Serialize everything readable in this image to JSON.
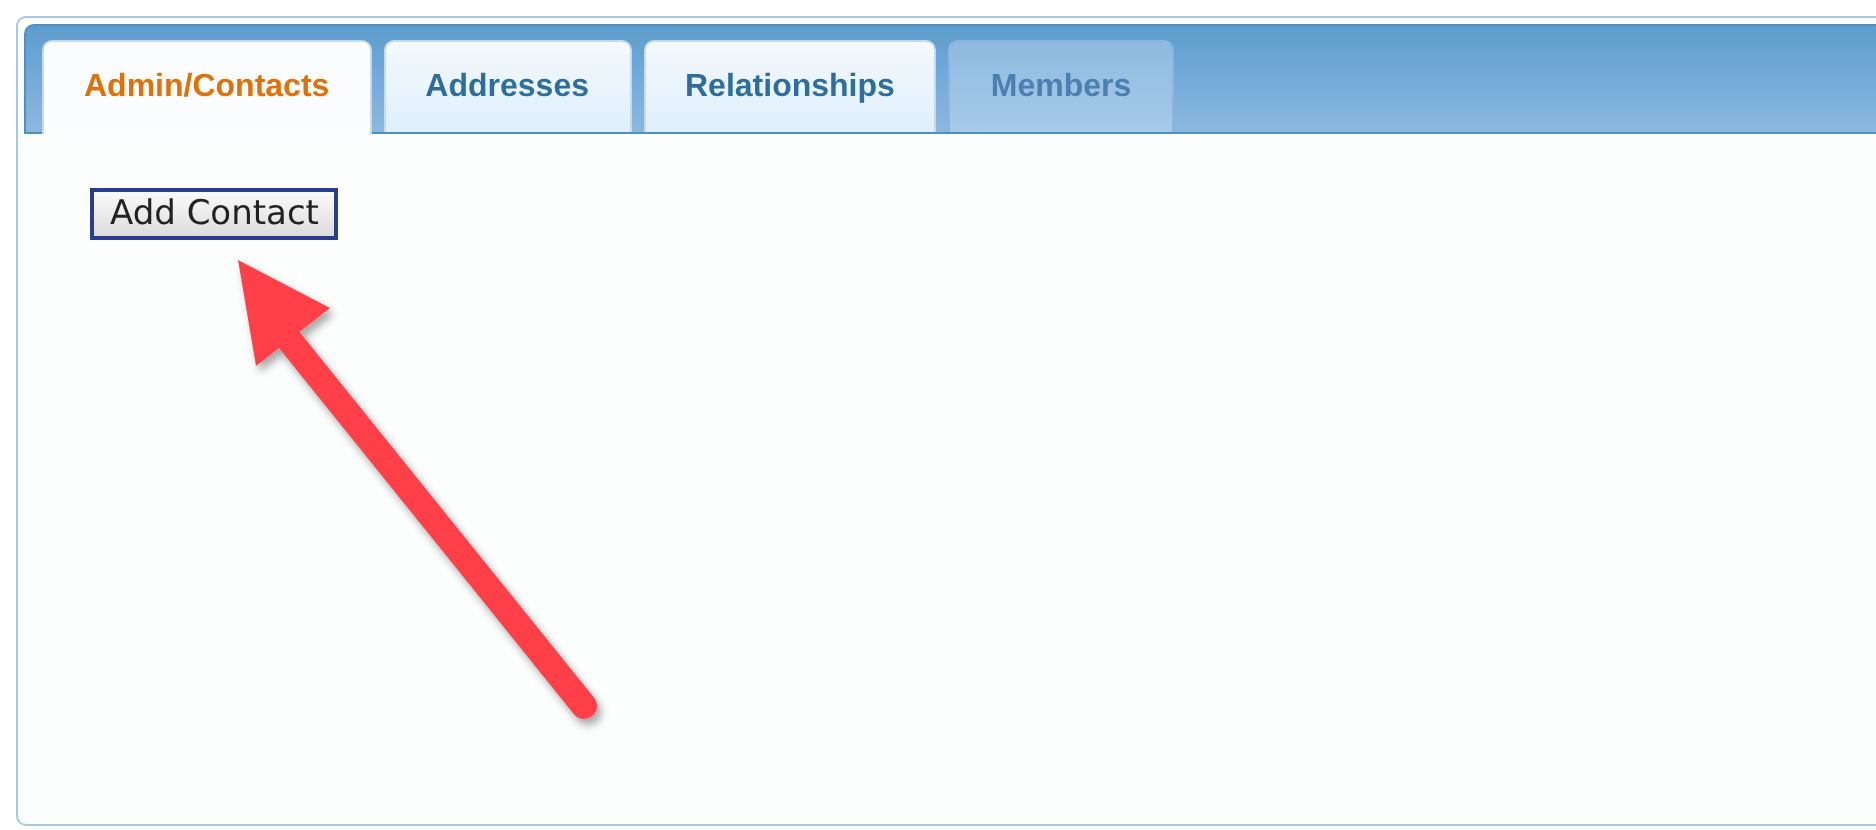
{
  "tabs": [
    {
      "label": "Admin/Contacts",
      "selected": true,
      "disabled": false
    },
    {
      "label": "Addresses",
      "selected": false,
      "disabled": false
    },
    {
      "label": "Relationships",
      "selected": false,
      "disabled": false
    },
    {
      "label": "Members",
      "selected": false,
      "disabled": true
    }
  ],
  "buttons": [
    "Add Contact"
  ]
}
